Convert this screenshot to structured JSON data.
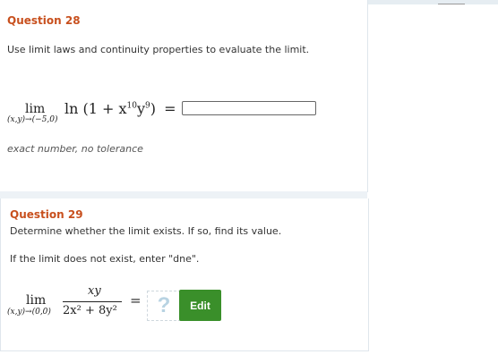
{
  "question28": {
    "title": "Question 28",
    "prompt": "Use limit laws and continuity properties to evaluate the limit.",
    "lim": "lim",
    "approach": "(x,y)→(−5,0)",
    "expression": "ln (1 + x",
    "exp10": "10",
    "yvar": "y",
    "exp9": "9",
    "close": ")",
    "equals": "=",
    "answer_value": "",
    "hint": "exact number, no tolerance"
  },
  "question29": {
    "title": "Question 29",
    "prompt": "Determine whether the limit exists. If so, find its value.",
    "instruction": "If the limit does not exist, enter \"dne\".",
    "lim": "lim",
    "approach": "(x,y)→(0,0)",
    "numerator": "xy",
    "denominator": "2x² + 8y²",
    "equals": "=",
    "placeholder_glyph": "?",
    "edit_label": "Edit",
    "edit_color": "#3a8f2a"
  },
  "colors": {
    "title": "#c8501e",
    "edit_button": "#3a8f2a",
    "placeholder": "#b8d3e2"
  }
}
